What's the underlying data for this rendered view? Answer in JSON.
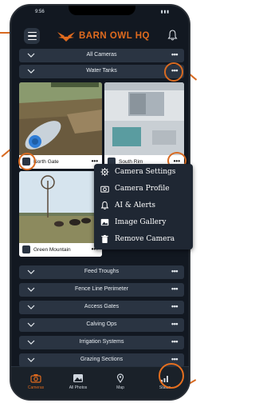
{
  "status_bar": {
    "time": "9:56",
    "signal": "▮▮▮"
  },
  "header": {
    "brand": "BARN OWL HQ",
    "brand_color": "#e06b1e"
  },
  "camera_groups": {
    "all": {
      "label": "All Cameras",
      "more": "•••"
    },
    "water_tanks": {
      "label": "Water Tanks",
      "more": "•••"
    }
  },
  "cameras": [
    {
      "name": "North Gate",
      "more": "•••"
    },
    {
      "name": "South Rim",
      "more": "•••"
    },
    {
      "name": "Green Mountain",
      "more": "•••"
    }
  ],
  "context_menu": {
    "items": [
      {
        "label": "Camera Settings",
        "icon": "gear-icon"
      },
      {
        "label": "Camera Profile",
        "icon": "camera-icon"
      },
      {
        "label": "AI & Alerts",
        "icon": "bell-icon"
      },
      {
        "label": "Image Gallery",
        "icon": "image-icon"
      },
      {
        "label": "Remove Camera",
        "icon": "trash-icon"
      }
    ]
  },
  "groups": [
    {
      "label": "Feed Troughs",
      "more": "•••"
    },
    {
      "label": "Fence Line Perimeter",
      "more": "•••"
    },
    {
      "label": "Access Gates",
      "more": "•••"
    },
    {
      "label": "Calving Ops",
      "more": "•••"
    },
    {
      "label": "Irrigation Systems",
      "more": "•••"
    },
    {
      "label": "Grazing Sections",
      "more": "•••"
    }
  ],
  "tabs": [
    {
      "label": "Cameras",
      "active": true
    },
    {
      "label": "All Photos",
      "active": false
    },
    {
      "label": "Map",
      "active": false
    },
    {
      "label": "Status",
      "active": false
    }
  ],
  "colors": {
    "accent": "#e06b1e",
    "panel": "#2a3442",
    "bg": "#121821"
  }
}
